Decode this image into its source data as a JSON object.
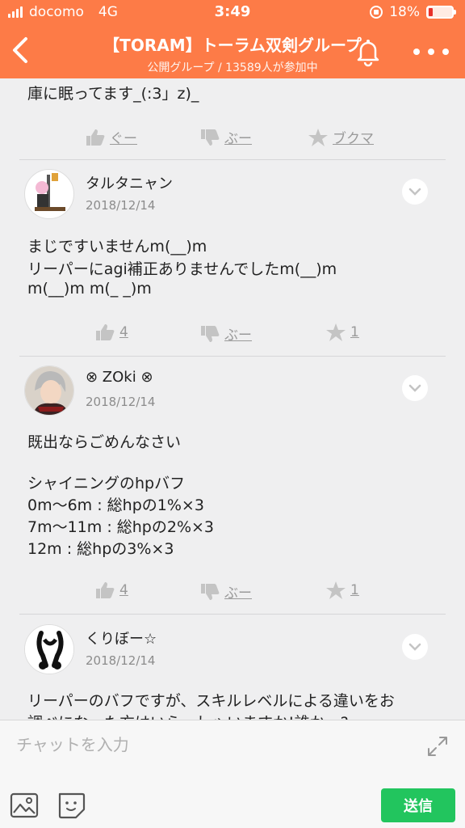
{
  "status_bar": {
    "carrier": "docomo",
    "network": "4G",
    "time": "3:49",
    "battery": "18%",
    "battery_level": 0.18
  },
  "header": {
    "title": "【TORAM】トーラム双剣グループ",
    "subtitle": "公開グループ / 13589人が参加中"
  },
  "feed": {
    "fragment_text": "庫に眠ってます_(:3」z)_",
    "fragment_actions": {
      "like": "ぐー",
      "dislike": "ぶー",
      "bookmark": "ブクマ"
    },
    "posts": [
      {
        "username": "タルタニャン",
        "date": "2018/12/14",
        "lines": [
          "まじですいませんm(__)m",
          "リーパーにagi補正ありませんでしたm(__)m",
          "m(__)m m(_ _)m"
        ],
        "likes": "4",
        "dislike_label": "ぶー",
        "bookmarks": "1"
      },
      {
        "username": "⊗ ZOki ⊗",
        "date": "2018/12/14",
        "lines": [
          "既出ならごめんなさい",
          "",
          "シャイニングのhpバフ",
          "0m〜6m : 総hpの1%×3",
          "7m〜11m : 総hpの2%×3",
          "12m : 総hpの3%×3"
        ],
        "likes": "4",
        "dislike_label": "ぶー",
        "bookmarks": "1"
      },
      {
        "username": "くりぼー☆",
        "date": "2018/12/14",
        "lines": [
          "リーパーのバフですが、スキルレベルによる違いをお",
          "調べになった方はいらっしゃいますか!誰か〜?"
        ]
      }
    ]
  },
  "input_bar": {
    "placeholder": "チャットを入力",
    "send_label": "送信"
  },
  "colors": {
    "accent": "#fd7b47",
    "send": "#22c55e"
  }
}
